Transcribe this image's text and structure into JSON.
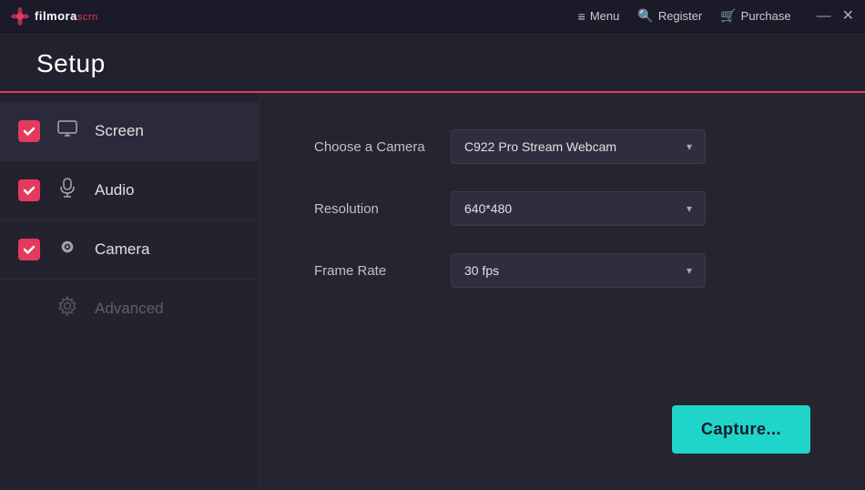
{
  "titlebar": {
    "logo_text": "filmora",
    "logo_scrn": "scrn",
    "menu_label": "Menu",
    "register_label": "Register",
    "purchase_label": "Purchase",
    "minimize_icon": "—",
    "close_icon": "✕"
  },
  "header": {
    "title": "Setup"
  },
  "sidebar": {
    "items": [
      {
        "id": "screen",
        "label": "Screen",
        "checked": true
      },
      {
        "id": "audio",
        "label": "Audio",
        "checked": true
      },
      {
        "id": "camera",
        "label": "Camera",
        "checked": true
      },
      {
        "id": "advanced",
        "label": "Advanced",
        "checked": false
      }
    ]
  },
  "content": {
    "camera_label": "Choose a Camera",
    "camera_value": "C922 Pro Stream Webcam",
    "resolution_label": "Resolution",
    "resolution_value": "640*480",
    "framerate_label": "Frame Rate",
    "framerate_value": "30 fps",
    "capture_label": "Capture..."
  }
}
